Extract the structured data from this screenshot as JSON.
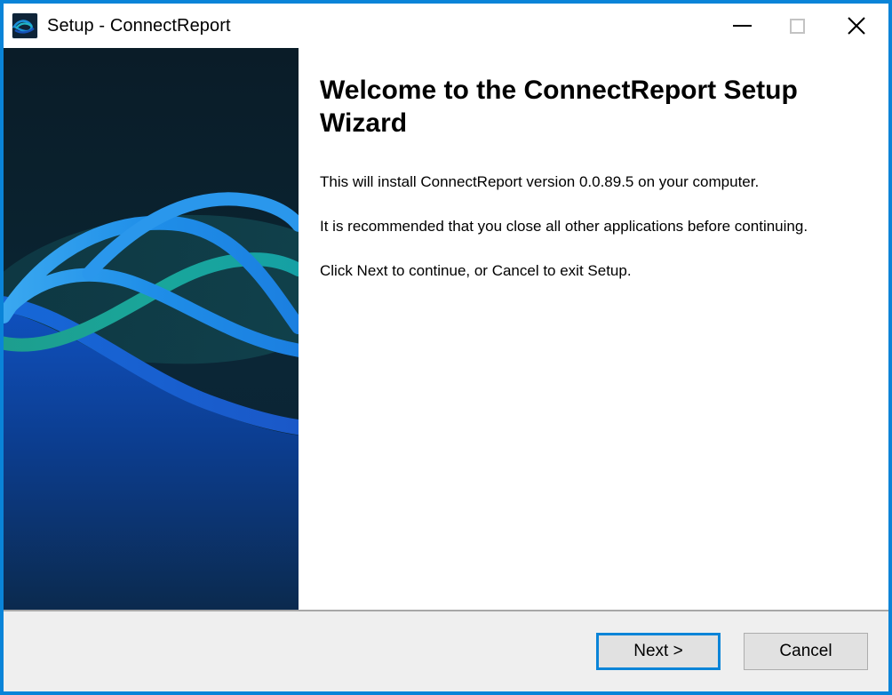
{
  "window": {
    "title": "Setup - ConnectReport",
    "icon": "connectreport-app-icon",
    "accent_color": "#0a84d8",
    "controls": {
      "minimize": "Minimize",
      "maximize": "Maximize",
      "close": "Close"
    }
  },
  "sidebar": {
    "graphic": "connectreport-wave-banner",
    "colors": {
      "background_top": "#0b1d2a",
      "background_bottom": "#0c2d52",
      "wave_blue": "#1e90e8",
      "wave_teal": "#1aa79a",
      "wave_deep_blue": "#0d47b0"
    }
  },
  "content": {
    "heading": "Welcome to the ConnectReport Setup Wizard",
    "paragraphs": [
      "This will install ConnectReport version 0.0.89.5 on your computer.",
      "It is recommended that you close all other applications before continuing.",
      "Click Next to continue, or Cancel to exit Setup."
    ],
    "product_name": "ConnectReport",
    "version": "0.0.89.5"
  },
  "footer": {
    "next_label": "Next >",
    "cancel_label": "Cancel"
  }
}
